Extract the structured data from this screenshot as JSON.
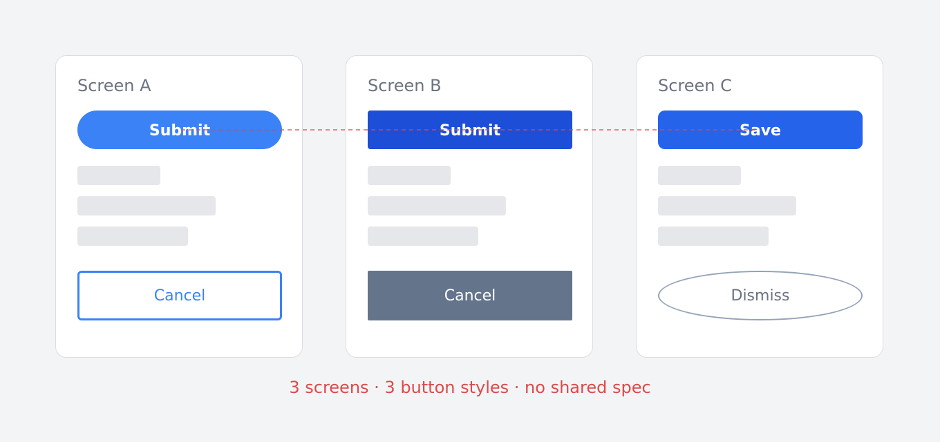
{
  "screens": [
    {
      "title": "Screen A",
      "primary_label": "Submit",
      "secondary_label": "Cancel"
    },
    {
      "title": "Screen B",
      "primary_label": "Submit",
      "secondary_label": "Cancel"
    },
    {
      "title": "Screen C",
      "primary_label": "Save",
      "secondary_label": "Dismiss"
    }
  ],
  "caption": "3 screens · 3 button styles · no shared spec",
  "colors": {
    "background": "#f3f4f6",
    "card": "#ffffff",
    "placeholder": "#e5e7eb",
    "title_text": "#6b7280",
    "screen_a_primary": "#3b82f6",
    "screen_b_primary": "#1d4ed8",
    "screen_c_primary": "#2563eb",
    "screen_b_secondary": "#64748b",
    "screen_c_secondary_border": "#94a3b8",
    "annotation": "#dc4a4a"
  }
}
